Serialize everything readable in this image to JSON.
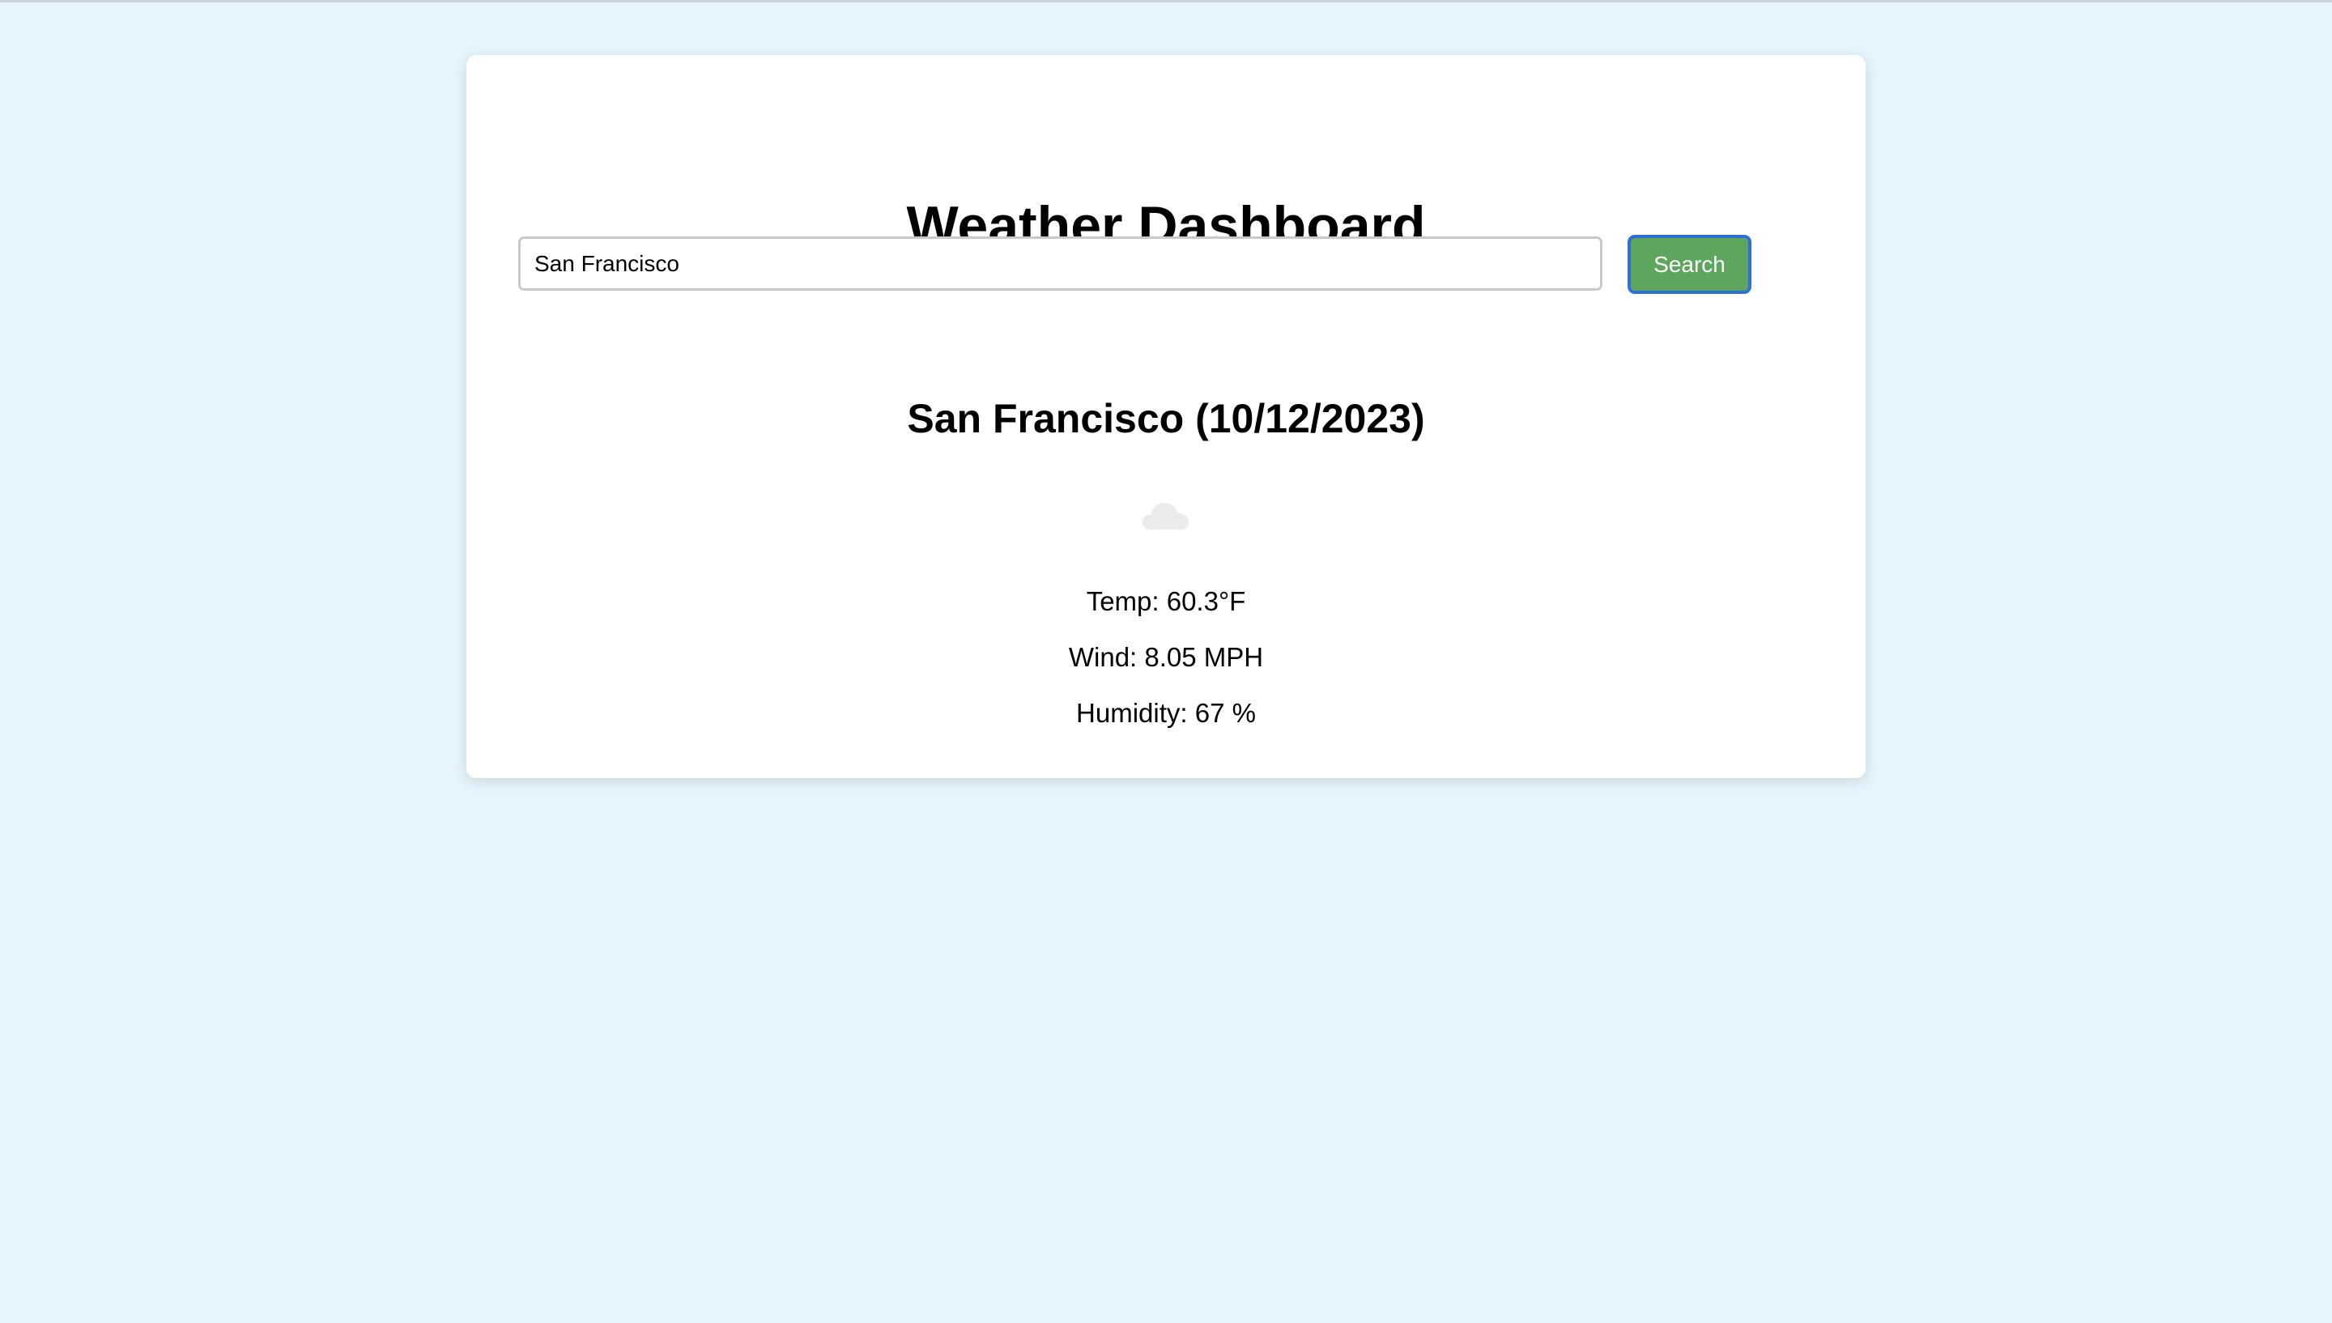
{
  "header": {
    "title": "Weather Dashboard"
  },
  "search": {
    "value": "San Francisco",
    "button_label": "Search"
  },
  "current": {
    "heading": "San Francisco (10/12/2023)",
    "icon": "cloud-icon",
    "temp": "Temp: 60.3°F",
    "wind": "Wind: 8.05 MPH",
    "humidity": "Humidity: 67 %"
  },
  "colors": {
    "background": "#e6f5fd",
    "button": "#5ea65e",
    "button_focus_border": "#2f6fd6"
  }
}
